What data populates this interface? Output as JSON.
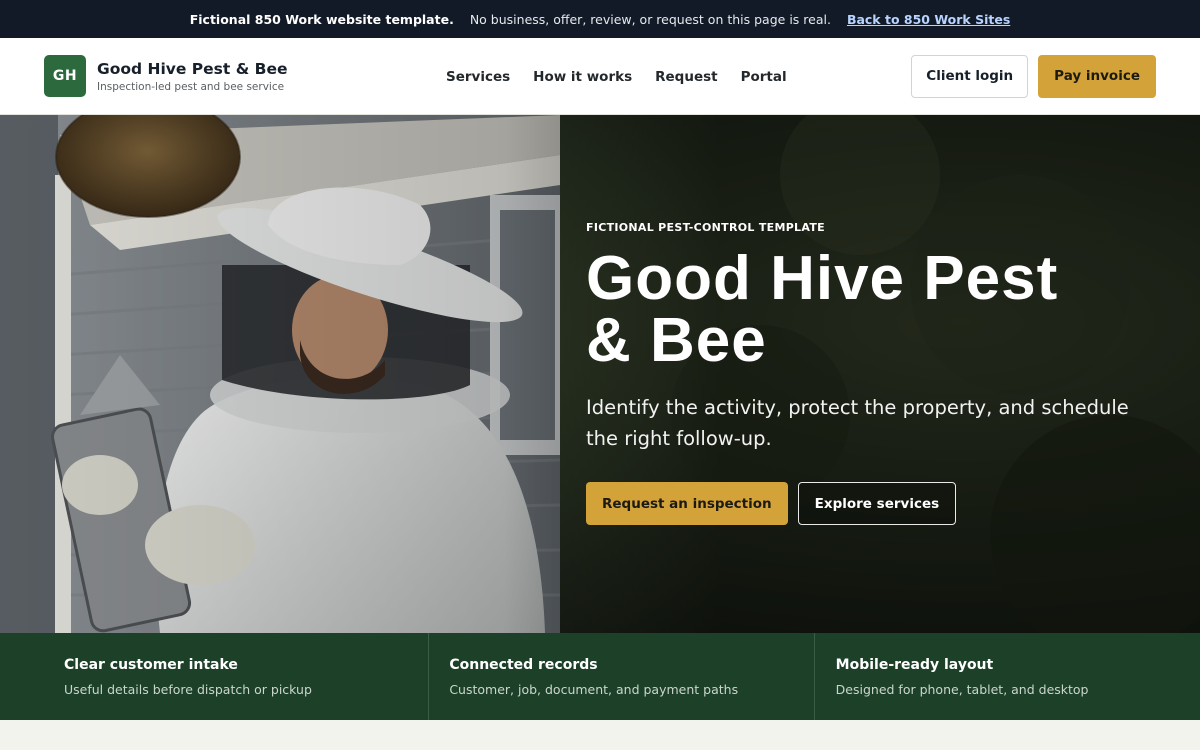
{
  "notice": {
    "strong": "Fictional 850 Work website template.",
    "text": "No business, offer, review, or request on this page is real.",
    "link": "Back to 850 Work Sites"
  },
  "brand": {
    "initials": "GH",
    "name": "Good Hive Pest & Bee",
    "tagline": "Inspection-led pest and bee service"
  },
  "nav": {
    "items": [
      "Services",
      "How it works",
      "Request",
      "Portal"
    ]
  },
  "header_actions": {
    "login": "Client login",
    "pay": "Pay invoice"
  },
  "hero": {
    "eyebrow": "FICTIONAL PEST-CONTROL TEMPLATE",
    "title_line1": "Good Hive Pest",
    "title_line2": "& Bee",
    "subtitle": "Identify the activity, protect the property, and schedule the right follow-up.",
    "primary_cta": "Request an inspection",
    "secondary_cta": "Explore services"
  },
  "features": [
    {
      "title": "Clear customer intake",
      "desc": "Useful details before dispatch or pickup"
    },
    {
      "title": "Connected records",
      "desc": "Customer, job, document, and payment paths"
    },
    {
      "title": "Mobile-ready layout",
      "desc": "Designed for phone, tablet, and desktop"
    }
  ],
  "colors": {
    "banner": "#111a26",
    "brand_green": "#2c6a3d",
    "gold": "#d3a33a",
    "feature_strip": "#1d4029"
  }
}
